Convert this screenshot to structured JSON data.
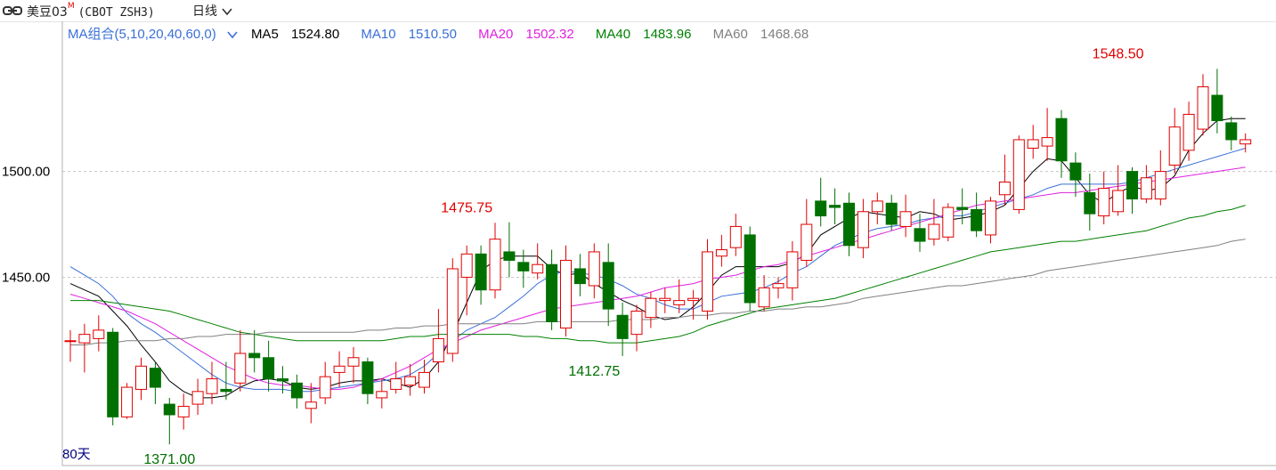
{
  "header": {
    "instrument": "美豆03",
    "instrument_sup": "M",
    "code": "(CBOT ZSH3)",
    "period": "日线"
  },
  "legend": {
    "combo": "MA组合(5,10,20,40,60,0)",
    "items": [
      {
        "label": "MA5",
        "value": "1524.80",
        "color": "#000000"
      },
      {
        "label": "MA10",
        "value": "1510.50",
        "color": "#3a6fd8"
      },
      {
        "label": "MA20",
        "value": "1502.32",
        "color": "#e020e0"
      },
      {
        "label": "MA40",
        "value": "1483.96",
        "color": "#008000"
      },
      {
        "label": "MA60",
        "value": "1468.68",
        "color": "#808080"
      }
    ]
  },
  "colors": {
    "up": "#e00000",
    "down": "#007000",
    "axis": "#b0b0b0",
    "grid": "#c8c8c8",
    "max_label": "#e00000",
    "min_label": "#007000"
  },
  "chart_data": {
    "type": "candlestick",
    "period_label": "80天",
    "y_ticks": [
      {
        "value": 1500,
        "label": "1500.00"
      },
      {
        "value": 1450,
        "label": "1450.00"
      }
    ],
    "ylim": [
      1361,
      1560
    ],
    "grid": true,
    "annotations": [
      {
        "index": 28,
        "value": 1475.75,
        "label": "1475.75",
        "kind": "high"
      },
      {
        "index": 37,
        "value": 1412.75,
        "label": "1412.75",
        "kind": "low"
      },
      {
        "index": 7,
        "value": 1371.0,
        "label": "1371.00",
        "kind": "low"
      },
      {
        "index": 74,
        "value": 1548.5,
        "label": "1548.50",
        "kind": "high"
      }
    ],
    "candles": [
      [
        1420,
        1420,
        1425,
        1410
      ],
      [
        1419,
        1423,
        1428,
        1405
      ],
      [
        1421,
        1425,
        1432,
        1415
      ],
      [
        1424,
        1384,
        1426,
        1380
      ],
      [
        1384,
        1398,
        1400,
        1383
      ],
      [
        1397,
        1408,
        1412,
        1392
      ],
      [
        1407,
        1398,
        1410,
        1390
      ],
      [
        1390,
        1385,
        1393,
        1371
      ],
      [
        1384,
        1389,
        1395,
        1378
      ],
      [
        1390,
        1396,
        1402,
        1385
      ],
      [
        1395,
        1402,
        1410,
        1390
      ],
      [
        1397,
        1396,
        1410,
        1392
      ],
      [
        1400,
        1414,
        1425,
        1396
      ],
      [
        1414,
        1412,
        1425,
        1405
      ],
      [
        1412,
        1402,
        1420,
        1396
      ],
      [
        1402,
        1401,
        1408,
        1395
      ],
      [
        1400,
        1393,
        1404,
        1388
      ],
      [
        1388,
        1391,
        1400,
        1381
      ],
      [
        1393,
        1403,
        1410,
        1390
      ],
      [
        1405,
        1408,
        1415,
        1398
      ],
      [
        1408,
        1412,
        1417,
        1400
      ],
      [
        1410,
        1395,
        1412,
        1390
      ],
      [
        1393,
        1396,
        1402,
        1388
      ],
      [
        1397,
        1402,
        1410,
        1395
      ],
      [
        1399,
        1403,
        1409,
        1394
      ],
      [
        1398,
        1405,
        1411,
        1395
      ],
      [
        1410,
        1421,
        1435,
        1405
      ],
      [
        1414,
        1454,
        1459,
        1410
      ],
      [
        1450,
        1461,
        1465,
        1432
      ],
      [
        1461,
        1444,
        1465,
        1437
      ],
      [
        1444,
        1468,
        1475.75,
        1440
      ],
      [
        1462,
        1458,
        1476,
        1450
      ],
      [
        1457,
        1453,
        1463,
        1445
      ],
      [
        1452,
        1456,
        1466,
        1449
      ],
      [
        1456,
        1429,
        1463,
        1425
      ],
      [
        1426,
        1458,
        1465,
        1422
      ],
      [
        1454,
        1447,
        1461,
        1441
      ],
      [
        1446,
        1462,
        1466,
        1440
      ],
      [
        1457,
        1435,
        1466,
        1427
      ],
      [
        1432,
        1421,
        1438,
        1412.75
      ],
      [
        1423,
        1434,
        1437,
        1415
      ],
      [
        1431,
        1440,
        1443,
        1426
      ],
      [
        1439,
        1440,
        1445,
        1433
      ],
      [
        1437,
        1439,
        1449,
        1433
      ],
      [
        1439,
        1440,
        1444,
        1430
      ],
      [
        1434,
        1462,
        1468,
        1430
      ],
      [
        1460,
        1463,
        1470,
        1455
      ],
      [
        1464,
        1474,
        1480,
        1460
      ],
      [
        1470,
        1438,
        1474,
        1434
      ],
      [
        1436,
        1445,
        1451,
        1434
      ],
      [
        1445,
        1447,
        1450,
        1440
      ],
      [
        1445,
        1462,
        1467,
        1439
      ],
      [
        1458,
        1475,
        1487,
        1455
      ],
      [
        1486,
        1479,
        1497,
        1474
      ],
      [
        1484,
        1483,
        1492,
        1475
      ],
      [
        1485,
        1465,
        1490,
        1460
      ],
      [
        1464,
        1481,
        1487,
        1459
      ],
      [
        1481,
        1486,
        1490,
        1475
      ],
      [
        1485,
        1475,
        1489,
        1472
      ],
      [
        1474,
        1481,
        1489,
        1469
      ],
      [
        1473,
        1467,
        1480,
        1462
      ],
      [
        1468,
        1475,
        1487,
        1465
      ],
      [
        1469,
        1483,
        1485,
        1467
      ],
      [
        1483,
        1482,
        1492,
        1475
      ],
      [
        1482,
        1472,
        1490,
        1469
      ],
      [
        1470,
        1486,
        1488,
        1466
      ],
      [
        1489,
        1495,
        1508,
        1484
      ],
      [
        1482,
        1515,
        1517,
        1480
      ],
      [
        1511,
        1515,
        1522,
        1506
      ],
      [
        1512,
        1516,
        1530,
        1505
      ],
      [
        1525,
        1505,
        1529,
        1497
      ],
      [
        1504,
        1496,
        1509,
        1488
      ],
      [
        1490,
        1480,
        1499,
        1472
      ],
      [
        1479,
        1492,
        1500,
        1475
      ],
      [
        1481,
        1491,
        1503,
        1479
      ],
      [
        1500,
        1487,
        1502,
        1480
      ],
      [
        1487,
        1497,
        1503,
        1485
      ],
      [
        1487,
        1500,
        1510,
        1484
      ],
      [
        1503,
        1521,
        1530,
        1499
      ],
      [
        1510,
        1527,
        1533,
        1505
      ],
      [
        1520,
        1540,
        1546,
        1517
      ],
      [
        1536,
        1524,
        1548.5,
        1518
      ],
      [
        1523,
        1515,
        1526,
        1510
      ],
      [
        1513,
        1515,
        1518,
        1509
      ]
    ],
    "series": [
      {
        "name": "MA5",
        "color": "#000000",
        "values": [
          1447,
          1444,
          1441,
          1434,
          1427,
          1418,
          1410,
          1401,
          1396,
          1393,
          1393,
          1394,
          1398,
          1401,
          1402,
          1401,
          1398,
          1397,
          1398,
          1400,
          1401,
          1401,
          1402,
          1400,
          1398,
          1402,
          1410,
          1423,
          1438,
          1453,
          1458,
          1460,
          1460,
          1460,
          1454,
          1451,
          1452,
          1447,
          1443,
          1439,
          1436,
          1432,
          1430,
          1431,
          1436,
          1443,
          1451,
          1455,
          1455,
          1455,
          1455,
          1457,
          1461,
          1470,
          1474,
          1478,
          1481,
          1480,
          1479,
          1478,
          1481,
          1480,
          1477,
          1478,
          1479,
          1481,
          1484,
          1492,
          1500,
          1506,
          1505,
          1497,
          1489,
          1485,
          1490,
          1493,
          1491,
          1492,
          1498,
          1510,
          1518,
          1524,
          1525,
          1525
        ]
      },
      {
        "name": "MA10",
        "color": "#3a6fd8",
        "values": [
          1455,
          1451,
          1447,
          1441,
          1433,
          1428,
          1424,
          1419,
          1414,
          1409,
          1404,
          1400,
          1398,
          1397,
          1397,
          1397,
          1396,
          1396,
          1397,
          1398,
          1399,
          1400,
          1401,
          1402,
          1404,
          1408,
          1414,
          1420,
          1425,
          1428,
          1431,
          1436,
          1441,
          1447,
          1451,
          1453,
          1452,
          1451,
          1449,
          1446,
          1442,
          1440,
          1437,
          1435,
          1435,
          1438,
          1441,
          1442,
          1443,
          1445,
          1448,
          1452,
          1455,
          1460,
          1465,
          1468,
          1471,
          1473,
          1474,
          1475,
          1477,
          1478,
          1479,
          1479,
          1481,
          1483,
          1485,
          1487,
          1489,
          1492,
          1494,
          1494,
          1494,
          1494,
          1494,
          1495,
          1497,
          1499,
          1501,
          1503,
          1505,
          1507,
          1509,
          1511
        ]
      },
      {
        "name": "MA20",
        "color": "#e020e0",
        "values": [
          1442,
          1440,
          1438,
          1436,
          1434,
          1431,
          1428,
          1424,
          1420,
          1416,
          1412,
          1408,
          1405,
          1402,
          1400,
          1399,
          1399,
          1398,
          1397,
          1397,
          1398,
          1400,
          1402,
          1405,
          1408,
          1412,
          1416,
          1419,
          1422,
          1425,
          1427,
          1429,
          1431,
          1433,
          1435,
          1436,
          1437,
          1438,
          1439,
          1440,
          1441,
          1443,
          1445,
          1446,
          1447,
          1449,
          1450,
          1451,
          1453,
          1455,
          1456,
          1458,
          1460,
          1462,
          1464,
          1466,
          1468,
          1470,
          1472,
          1474,
          1476,
          1478,
          1480,
          1482,
          1484,
          1485,
          1486,
          1487,
          1488,
          1489,
          1490,
          1490,
          1491,
          1492,
          1493,
          1494,
          1495,
          1496,
          1497,
          1498,
          1499,
          1500,
          1501,
          1502
        ]
      },
      {
        "name": "MA40",
        "color": "#008000",
        "values": [
          1439,
          1439,
          1439,
          1438,
          1437,
          1436,
          1435,
          1434,
          1432,
          1430,
          1428,
          1426,
          1424,
          1423,
          1422,
          1421,
          1420,
          1420,
          1420,
          1420,
          1420,
          1420,
          1420,
          1421,
          1422,
          1422,
          1423,
          1423,
          1423,
          1423,
          1423,
          1423,
          1422,
          1422,
          1421,
          1421,
          1420,
          1420,
          1419,
          1419,
          1419,
          1420,
          1421,
          1422,
          1424,
          1427,
          1429,
          1431,
          1433,
          1435,
          1436,
          1437,
          1438,
          1439,
          1440,
          1442,
          1444,
          1446,
          1448,
          1450,
          1452,
          1454,
          1456,
          1458,
          1460,
          1462,
          1463,
          1464,
          1465,
          1466,
          1467,
          1467,
          1468,
          1469,
          1470,
          1471,
          1472,
          1474,
          1476,
          1478,
          1479,
          1481,
          1482,
          1484
        ]
      },
      {
        "name": "MA60",
        "color": "#808080",
        "values": [
          1418,
          1418,
          1419,
          1419,
          1420,
          1420,
          1420,
          1421,
          1421,
          1422,
          1422,
          1423,
          1423,
          1423,
          1424,
          1424,
          1424,
          1424,
          1424,
          1424,
          1424,
          1425,
          1425,
          1426,
          1426,
          1427,
          1427,
          1428,
          1428,
          1428,
          1428,
          1428,
          1428,
          1429,
          1429,
          1429,
          1429,
          1429,
          1429,
          1430,
          1430,
          1430,
          1431,
          1431,
          1432,
          1432,
          1433,
          1433,
          1434,
          1434,
          1435,
          1435,
          1436,
          1436,
          1437,
          1438,
          1440,
          1441,
          1442,
          1443,
          1444,
          1445,
          1446,
          1446,
          1447,
          1448,
          1449,
          1450,
          1451,
          1453,
          1454,
          1455,
          1456,
          1457,
          1458,
          1459,
          1460,
          1461,
          1462,
          1463,
          1464,
          1465,
          1467,
          1468
        ]
      }
    ]
  }
}
